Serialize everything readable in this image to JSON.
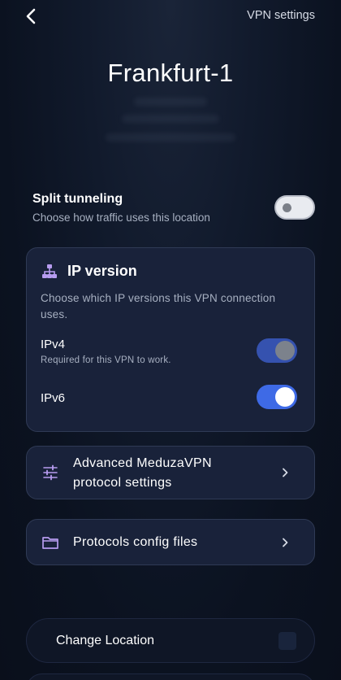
{
  "header": {
    "back_icon": "chevron-left-icon",
    "vpn_settings_label": "VPN settings"
  },
  "location": {
    "title": "Frankfurt-1"
  },
  "split_tunneling": {
    "title": "Split tunneling",
    "subtitle": "Choose how traffic uses this location",
    "enabled": false
  },
  "ip_version": {
    "icon": "network-icon",
    "title": "IP version",
    "description": "Choose which IP versions this VPN connection uses.",
    "options": [
      {
        "label": "IPv4",
        "sublabel": "Required for this VPN to work.",
        "enabled": true,
        "disabled": true
      },
      {
        "label": "IPv6",
        "enabled": true
      }
    ]
  },
  "rows": {
    "advanced": {
      "icon": "sliders-icon",
      "label": "Advanced MeduzaVPN protocol settings"
    },
    "config_files": {
      "icon": "folder-icon",
      "label": "Protocols config files"
    }
  },
  "actions": {
    "change_location": "Change Location"
  },
  "colors": {
    "accent": "#3e6ae6",
    "icon_purple": "#b79cf0",
    "card_bg": "#19223a",
    "background": "#0d1424"
  }
}
